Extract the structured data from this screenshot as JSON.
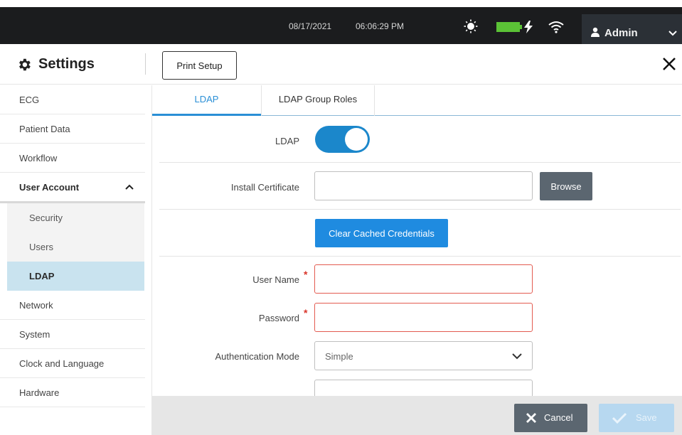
{
  "status_bar": {
    "date": "08/17/2021",
    "time": "06:06:29 PM",
    "user_label": "Admin"
  },
  "header": {
    "title": "Settings",
    "print_setup_label": "Print Setup"
  },
  "sidebar": {
    "items": [
      {
        "label": "ECG"
      },
      {
        "label": "Patient Data"
      },
      {
        "label": "Workflow"
      },
      {
        "label": "User Account",
        "expanded": true
      },
      {
        "label": "Security"
      },
      {
        "label": "Users"
      },
      {
        "label": "LDAP",
        "active": true
      },
      {
        "label": "Network"
      },
      {
        "label": "System"
      },
      {
        "label": "Clock and Language"
      },
      {
        "label": "Hardware"
      }
    ]
  },
  "tabs": [
    {
      "label": "LDAP",
      "active": true
    },
    {
      "label": "LDAP Group Roles",
      "active": false
    }
  ],
  "form": {
    "ldap_label": "LDAP",
    "ldap_enabled": true,
    "install_cert_label": "Install Certificate",
    "install_cert_value": "",
    "browse_label": "Browse",
    "clear_cached_label": "Clear Cached Credentials",
    "user_name_label": "User Name",
    "user_name_value": "",
    "password_label": "Password",
    "password_value": "",
    "required_mark": "*",
    "auth_mode_label": "Authentication Mode",
    "auth_mode_value": "Simple"
  },
  "footer": {
    "cancel_label": "Cancel",
    "save_label": "Save"
  },
  "colors": {
    "accent": "#1f8be0",
    "toggle_on": "#1b87cb",
    "error": "#e35b50",
    "active_nav_bg": "#c9e3ef",
    "topbar_bg": "#1b1c1e",
    "battery": "#5bc236"
  }
}
